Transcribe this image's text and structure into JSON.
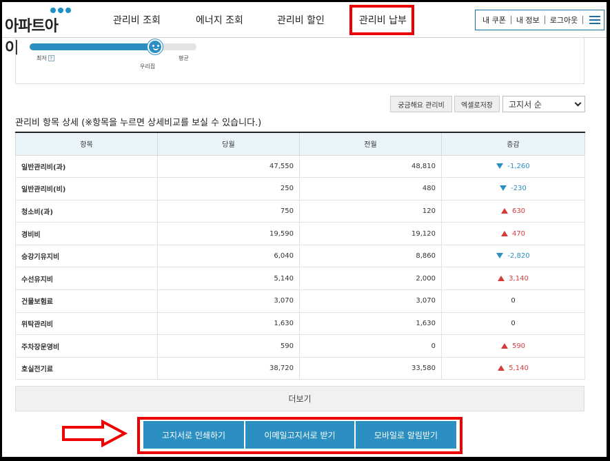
{
  "header": {
    "logo": "아파트아이",
    "nav": [
      {
        "label": "관리비 조회"
      },
      {
        "label": "에너지 조회"
      },
      {
        "label": "관리비 할인"
      },
      {
        "label": "관리비 납부",
        "highlighted": true
      }
    ],
    "util": {
      "coupon": "내 쿠폰",
      "info": "내 정보",
      "logout": "로그아웃"
    }
  },
  "gauge": {
    "label_min": "최저",
    "help": "?",
    "label_ours": "우리집",
    "label_avg": "평균",
    "ours_level_percent": 75
  },
  "toolbar": {
    "btn_curious": "궁금해요 관리비",
    "btn_excel": "엑셀로저장",
    "sort_value": "고지서 순"
  },
  "section_title": "관리비 항목 상세 (※항목을 누르면 상세비교를 보실 수 있습니다.)",
  "table": {
    "headers": [
      "항목",
      "당월",
      "전월",
      "증감"
    ],
    "rows": [
      {
        "item": "일반관리비(과)",
        "current": "47,550",
        "previous": "48,810",
        "change": "-1,260",
        "dir": "down"
      },
      {
        "item": "일반관리비(비)",
        "current": "250",
        "previous": "480",
        "change": "-230",
        "dir": "down"
      },
      {
        "item": "청소비(과)",
        "current": "750",
        "previous": "120",
        "change": "630",
        "dir": "up"
      },
      {
        "item": "경비비",
        "current": "19,590",
        "previous": "19,120",
        "change": "470",
        "dir": "up"
      },
      {
        "item": "승강기유지비",
        "current": "6,040",
        "previous": "8,860",
        "change": "-2,820",
        "dir": "down"
      },
      {
        "item": "수선유지비",
        "current": "5,140",
        "previous": "2,000",
        "change": "3,140",
        "dir": "up"
      },
      {
        "item": "건물보험료",
        "current": "3,070",
        "previous": "3,070",
        "change": "0",
        "dir": "none"
      },
      {
        "item": "위탁관리비",
        "current": "1,630",
        "previous": "1,630",
        "change": "0",
        "dir": "none"
      },
      {
        "item": "주차장운영비",
        "current": "590",
        "previous": "0",
        "change": "590",
        "dir": "up"
      },
      {
        "item": "호실전기료",
        "current": "38,720",
        "previous": "33,580",
        "change": "5,140",
        "dir": "up"
      }
    ]
  },
  "more_label": "더보기",
  "actions": {
    "print": "고지서로 인쇄하기",
    "email": "이메일고지서로 받기",
    "mobile": "모바일로 알림받기"
  },
  "colors": {
    "accent": "#2b8fc1",
    "highlight_border": "#ee0000",
    "increase": "#d63b3b",
    "decrease": "#2b8fc1",
    "table_header_bg": "#eaf5fb"
  }
}
